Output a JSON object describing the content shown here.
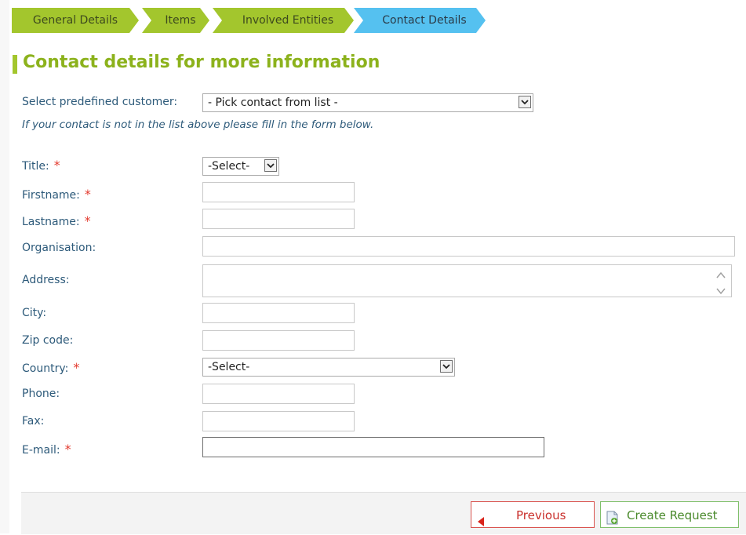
{
  "wizard": {
    "steps": [
      {
        "label": "General Details",
        "state": "done"
      },
      {
        "label": "Items",
        "state": "done"
      },
      {
        "label": "Involved Entities",
        "state": "done"
      },
      {
        "label": "Contact Details",
        "state": "active"
      }
    ]
  },
  "page": {
    "heading": "Contact details for more information"
  },
  "predefined": {
    "label": "Select predefined customer:",
    "selected": "- Pick contact from list -",
    "note": "If your contact is not in the list above please fill in the form below."
  },
  "form": {
    "title": {
      "label": "Title:",
      "required": "*",
      "selected": "-Select-"
    },
    "firstname": {
      "label": "Firstname:",
      "required": "*",
      "value": ""
    },
    "lastname": {
      "label": "Lastname:",
      "required": "*",
      "value": ""
    },
    "organisation": {
      "label": "Organisation:",
      "value": ""
    },
    "address": {
      "label": "Address:",
      "value": ""
    },
    "city": {
      "label": "City:",
      "value": ""
    },
    "zip": {
      "label": "Zip code:",
      "value": ""
    },
    "country": {
      "label": "Country:",
      "required": "*",
      "selected": "-Select-"
    },
    "phone": {
      "label": "Phone:",
      "value": ""
    },
    "fax": {
      "label": "Fax:",
      "value": ""
    },
    "email": {
      "label": "E-mail:",
      "required": "*",
      "value": ""
    }
  },
  "buttons": {
    "previous": "Previous",
    "create": "Create Request"
  },
  "colors": {
    "step_done": "#a3c62d",
    "step_active": "#55c1f0",
    "heading": "#8cb21c",
    "required": "#e33a2e",
    "label": "#2d5a7a"
  },
  "icons": {
    "previous": "left-triangle-icon",
    "create": "document-add-icon",
    "dropdown": "chevron-down-icon"
  }
}
